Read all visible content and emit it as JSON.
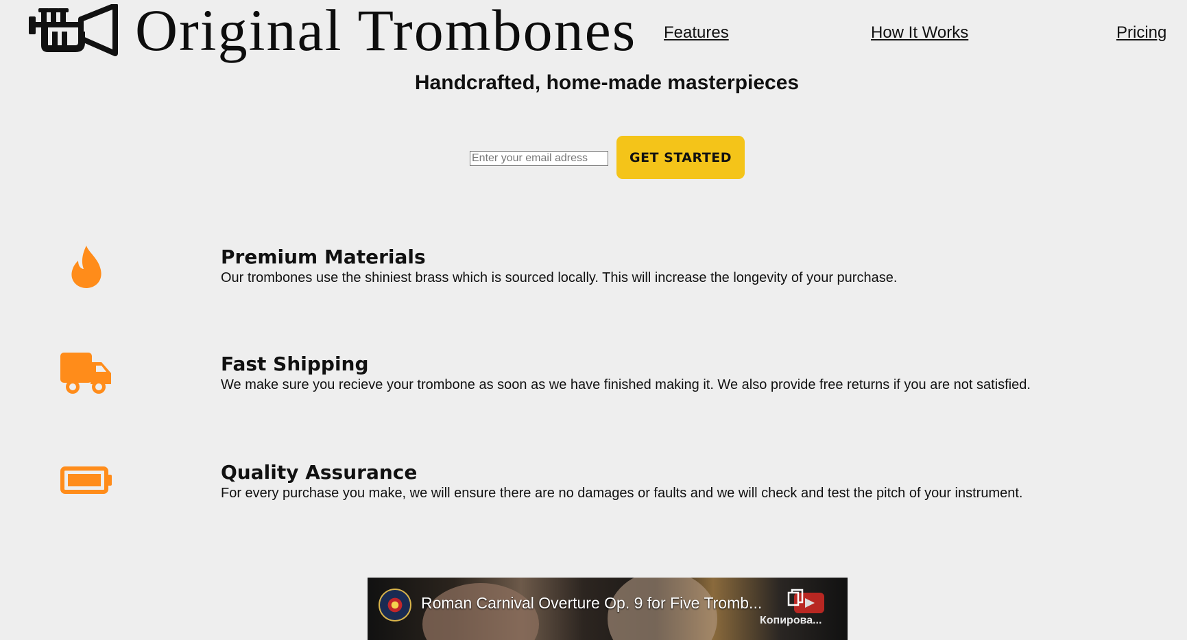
{
  "header": {
    "brand": "Original Trombones",
    "nav": [
      {
        "label": "Features"
      },
      {
        "label": "How It Works"
      },
      {
        "label": "Pricing"
      }
    ]
  },
  "hero": {
    "tagline": "Handcrafted, home-made masterpieces",
    "email_placeholder": "Enter your email adress",
    "cta_label": "GET STARTED"
  },
  "features": [
    {
      "icon": "flame-icon",
      "title": "Premium Materials",
      "text": "Our trombones use the shiniest brass which is sourced locally. This will increase the longevity of your purchase."
    },
    {
      "icon": "truck-icon",
      "title": "Fast Shipping",
      "text": "We make sure you recieve your trombone as soon as we have finished making it. We also provide free returns if you are not satisfied."
    },
    {
      "icon": "battery-icon",
      "title": "Quality Assurance",
      "text": "For every purchase you make, we will ensure there are no damages or faults and we will check and test the pitch of your instrument."
    }
  ],
  "video": {
    "title": "Roman Carnival Overture Op. 9 for Five Tromb...",
    "copy_label": "Копирова..."
  },
  "colors": {
    "accent": "#f4c419",
    "icon": "#ff8c1a",
    "background": "#eeeeee"
  }
}
